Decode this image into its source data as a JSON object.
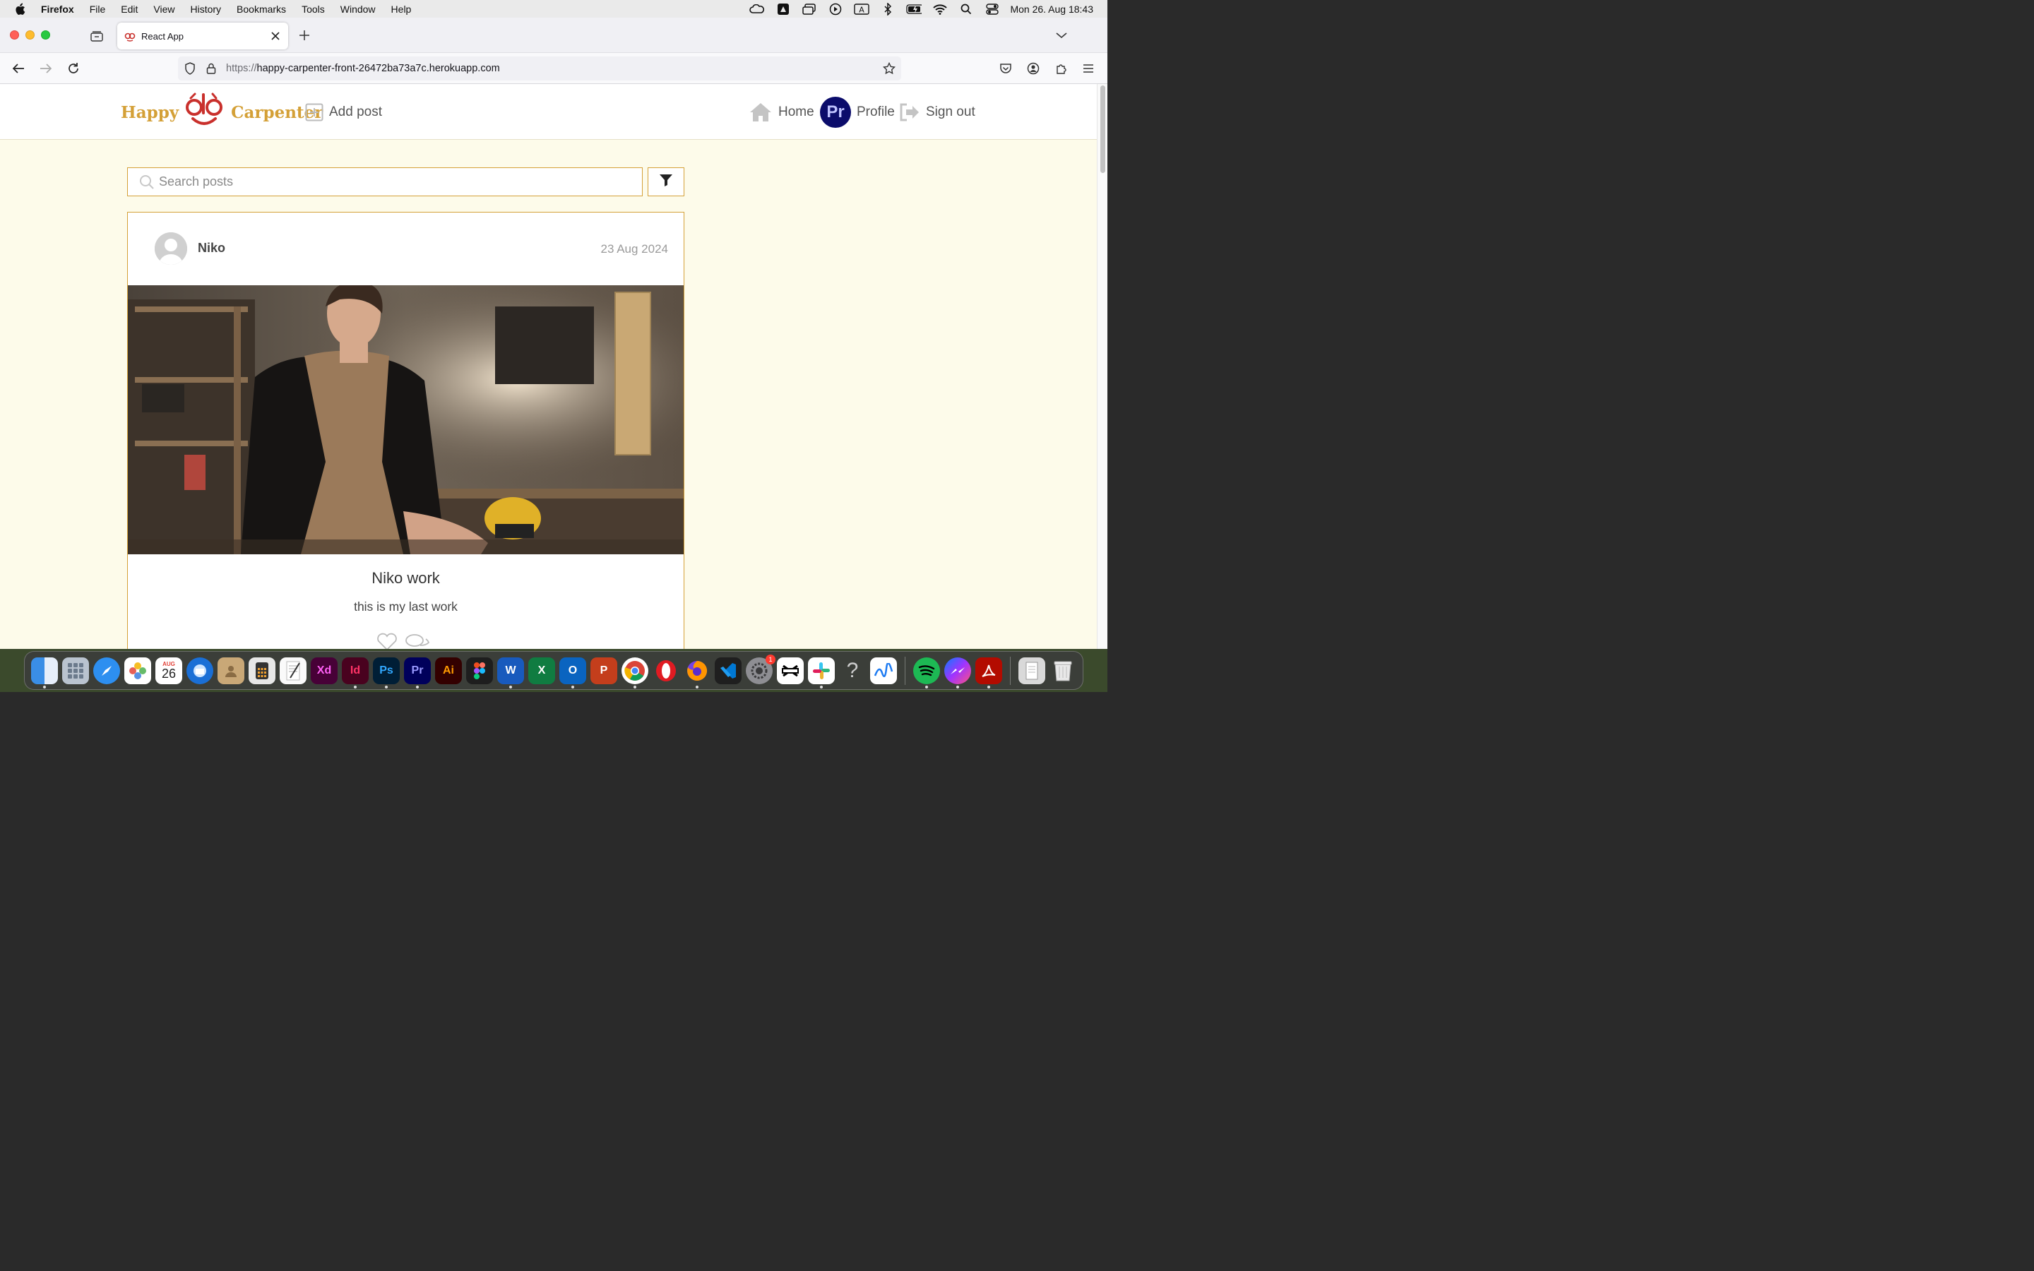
{
  "menubar": {
    "app": "Firefox",
    "items": [
      "File",
      "Edit",
      "View",
      "History",
      "Bookmarks",
      "Tools",
      "Window",
      "Help"
    ],
    "clock": "Mon 26. Aug  18:43"
  },
  "browser": {
    "tab_title": "React App",
    "url_protocol": "https://",
    "url_host": "happy-carpenter-front-26472ba73a7c.herokuapp.com"
  },
  "site": {
    "logo_left": "Happy",
    "logo_right": "Carpenter",
    "add_post": "Add post",
    "home": "Home",
    "profile_initials": "Pr",
    "profile": "Profile",
    "sign_out": "Sign out"
  },
  "search": {
    "placeholder": "Search posts"
  },
  "post": {
    "author": "Niko",
    "date": "23 Aug 2024",
    "title": "Niko work",
    "body": "this is my last work"
  },
  "dock": {
    "calendar_month": "AUG",
    "calendar_day": "26",
    "settings_badge": "1",
    "apps": [
      "Finder",
      "Launchpad",
      "Safari",
      "Photos",
      "Calendar",
      "Thunderbird",
      "Contacts",
      "Calculator",
      "TextEdit",
      "Xd",
      "Id",
      "Ps",
      "Pr",
      "Ai",
      "Figma",
      "Word",
      "Excel",
      "Outlook",
      "PowerPoint",
      "Chrome",
      "Opera",
      "Firefox",
      "VS Code",
      "System Settings",
      "CapCut",
      "Slack",
      "Help",
      "Freeform",
      "Spotify",
      "Messenger",
      "Acrobat",
      "Downloads",
      "Trash"
    ]
  },
  "colors": {
    "accent": "#d4a037",
    "page_bg": "#fdfbea",
    "logo_red": "#c9302c",
    "profile_bg": "#0b0c6b"
  }
}
